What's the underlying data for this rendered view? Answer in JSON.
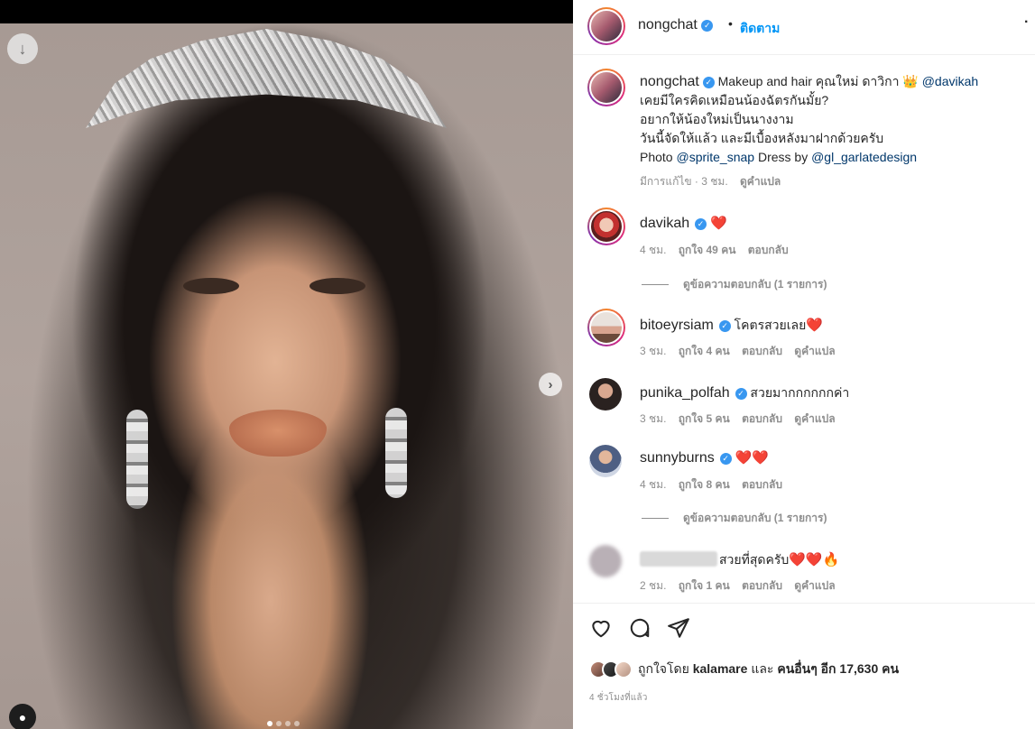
{
  "post": {
    "author": "nongchat",
    "follow_label": "ติดตาม",
    "separator": "•",
    "more_glyph": "·"
  },
  "caption": {
    "username": "nongchat",
    "line1_text": "Makeup and hair คุณใหม่ ดาวิกา",
    "line1_emoji": "👑",
    "line1_mention": "@davikah",
    "line2": "เคยมีใครคิดเหมือนน้องฉัตรกันมั้ย?",
    "line3": "อยากให้น้องใหม่เป็นนางงาม",
    "line4": "วันนี้จัดให้แล้ว และมีเบื้องหลังมาฝากด้วยครับ",
    "line5_prefix": "Photo",
    "line5_mention1": "@sprite_snap",
    "line5_mid": "Dress by",
    "line5_mention2": "@gl_garlatedesign",
    "meta_edited": "มีการแก้ไข · 3 ชม.",
    "meta_translate": "ดูคำแปล"
  },
  "comments": [
    {
      "username": "davikah",
      "text": "",
      "emoji": "❤️",
      "time": "4 ชม.",
      "likes": "ถูกใจ 49 คน",
      "reply": "ตอบกลับ",
      "translate": ""
    },
    {
      "username": "bitoeyrsiam",
      "text": "โคตรสวยเลย",
      "emoji": "❤️",
      "time": "3 ชม.",
      "likes": "ถูกใจ 4 คน",
      "reply": "ตอบกลับ",
      "translate": "ดูคำแปล"
    },
    {
      "username": "punika_polfah",
      "text": "สวยมากกกกกกค่า",
      "emoji": "",
      "time": "3 ชม.",
      "likes": "ถูกใจ 5 คน",
      "reply": "ตอบกลับ",
      "translate": "ดูคำแปล"
    },
    {
      "username": "sunnyburns",
      "text": "",
      "emoji": "❤️❤️",
      "time": "4 ชม.",
      "likes": "ถูกใจ 8 คน",
      "reply": "ตอบกลับ",
      "translate": ""
    },
    {
      "username": "",
      "text": "สวยที่สุดครับ",
      "emoji": "❤️❤️🔥",
      "time": "2 ชม.",
      "likes": "ถูกใจ 1 คน",
      "reply": "ตอบกลับ",
      "translate": "ดูคำแปล"
    }
  ],
  "view_replies": [
    "ดูข้อความตอบกลับ (1 รายการ)",
    "ดูข้อความตอบกลับ (1 รายการ)"
  ],
  "likes": {
    "prefix": "ถูกใจโดย",
    "user": "kalamare",
    "mid": "และ",
    "others": "คนอื่นๆ อีก 17,630 คน"
  },
  "time_ago": "4 ชั่วโมงที่แล้ว",
  "icons": {
    "download": "arrow-down-icon",
    "next": "chevron-right-icon",
    "user_tag": "person-icon",
    "like": "heart-icon",
    "comment": "speech-bubble-icon",
    "share": "paper-plane-icon",
    "verified": "verified-badge-icon"
  },
  "colors": {
    "accent": "#0095f6",
    "link": "#00376b",
    "verified": "#3897f0",
    "heart": "#e0245e",
    "muted": "#8e8e8e"
  }
}
